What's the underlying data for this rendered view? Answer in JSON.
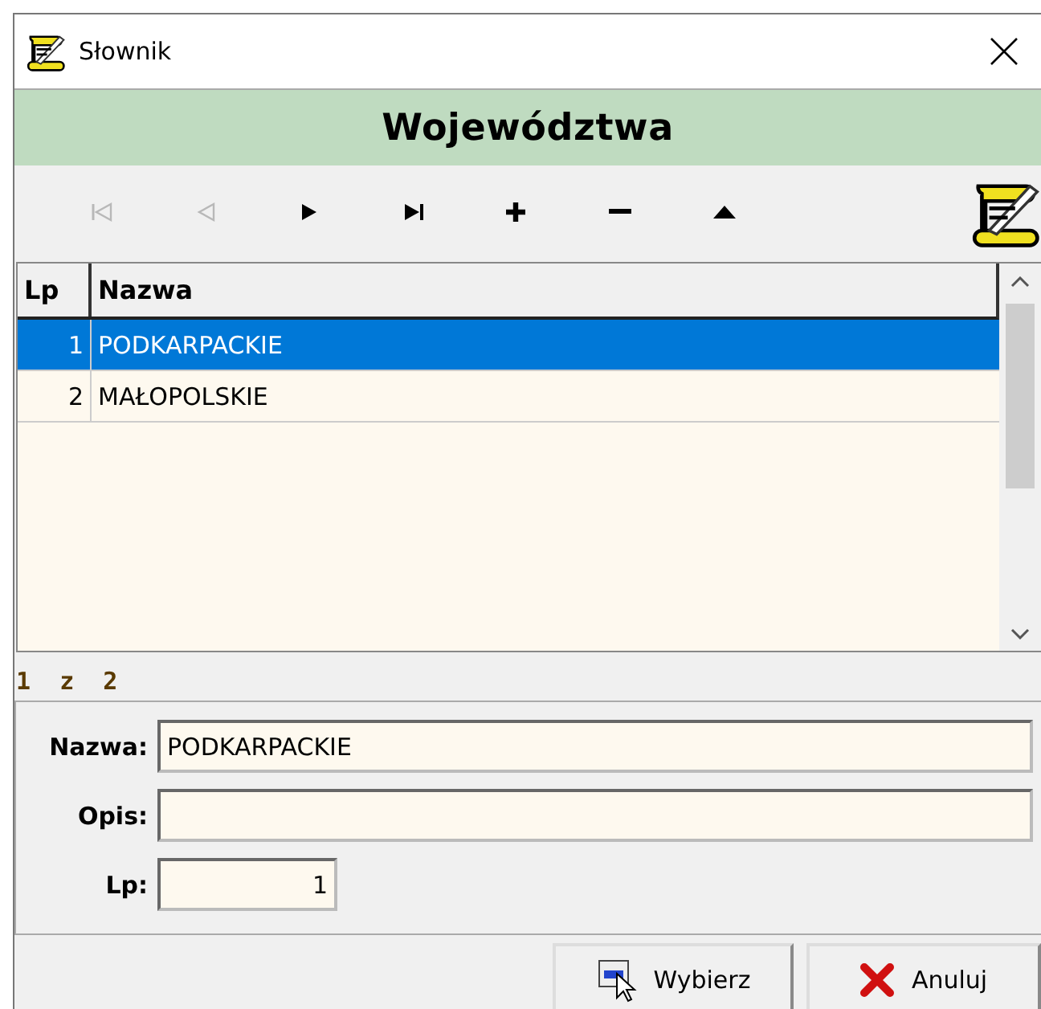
{
  "window": {
    "title": "Słownik"
  },
  "header": "Województwa",
  "toolbar": [
    {
      "kind": "first",
      "disabled": true
    },
    {
      "kind": "prev",
      "disabled": true
    },
    {
      "kind": "next",
      "disabled": false
    },
    {
      "kind": "last",
      "disabled": false
    },
    {
      "kind": "add",
      "disabled": false
    },
    {
      "kind": "delete",
      "disabled": false
    },
    {
      "kind": "up",
      "disabled": false
    }
  ],
  "table": {
    "columns": [
      "Lp",
      "Nazwa"
    ],
    "rows": [
      {
        "cells": [
          "1",
          "PODKARPACKIE"
        ],
        "selected": true
      },
      {
        "cells": [
          "2",
          "MAŁOPOLSKIE"
        ],
        "selected": false
      }
    ]
  },
  "counter": "1  z  2",
  "form": {
    "fields": [
      {
        "label": "Nazwa:",
        "value": "PODKARPACKIE",
        "kind": "wide"
      },
      {
        "label": "Opis:",
        "kind": "wide"
      },
      {
        "label": "Lp:",
        "value": "1",
        "kind": "number"
      }
    ]
  },
  "buttons": [
    {
      "label": "Wybierz",
      "kind": "select"
    },
    {
      "label": "Anuluj",
      "kind": "cancel"
    }
  ]
}
